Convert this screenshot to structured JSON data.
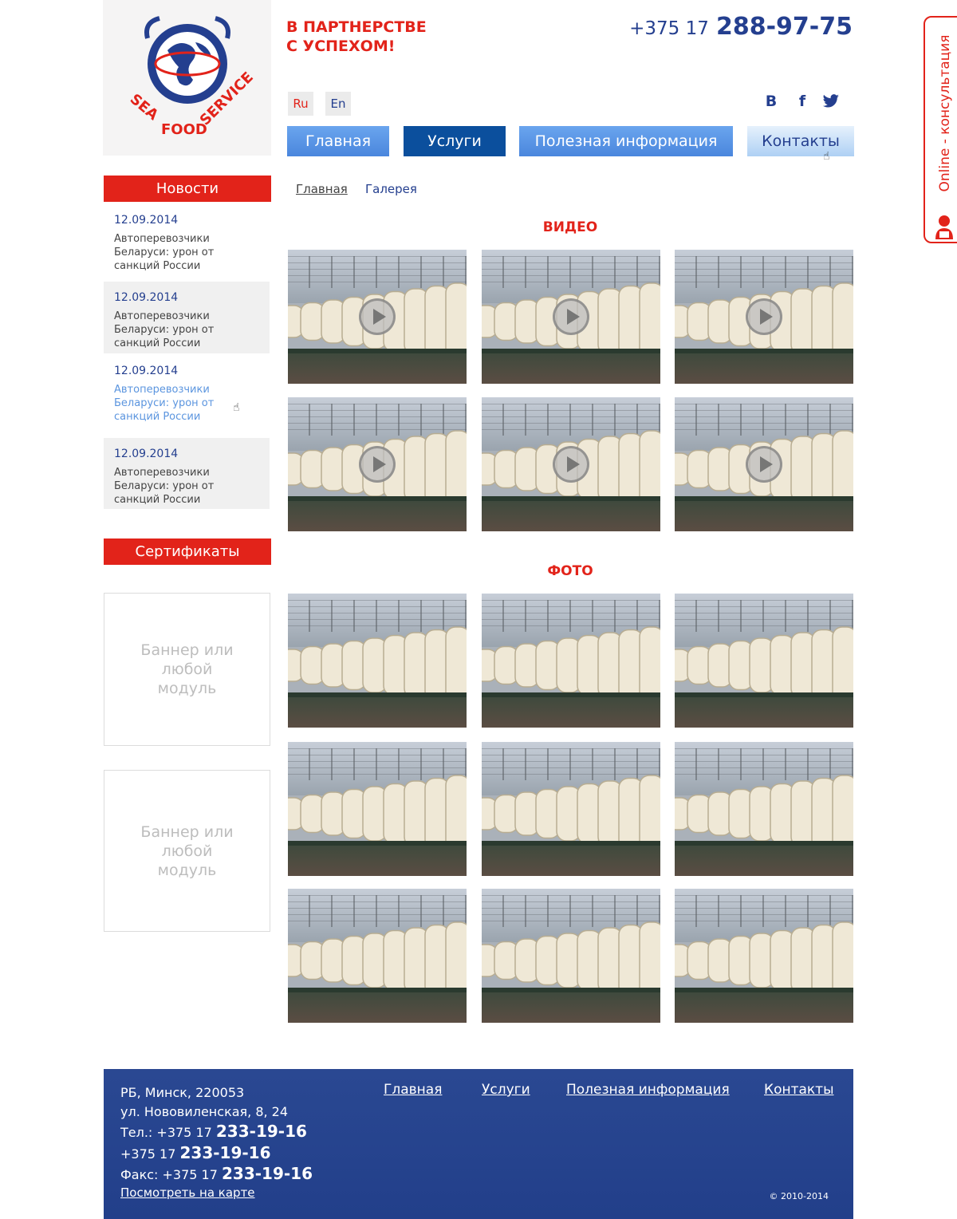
{
  "logo": {
    "text": "SEA FOOD SERVICE"
  },
  "header": {
    "slogan_line1": "В ПАРТНЕРСТВЕ",
    "slogan_line2": "С УСПЕХОМ!",
    "phone_prefix": "+375 17",
    "phone_number": "288-97-75"
  },
  "languages": [
    "Ru",
    "En"
  ],
  "social": [
    "B",
    "f",
    "twitter-icon"
  ],
  "nav": [
    {
      "label": "Главная"
    },
    {
      "label": "Услуги"
    },
    {
      "label": "Полезная информация"
    },
    {
      "label": "Контакты"
    }
  ],
  "sidebar": {
    "news_title": "Новости",
    "news": [
      {
        "date": "12.09.2014",
        "text": "Автоперевозчики Беларуси: урон от санкций России"
      },
      {
        "date": "12.09.2014",
        "text": "Автоперевозчики Беларуси: урон от санкций России"
      },
      {
        "date": "12.09.2014",
        "text": "Автоперевозчики Беларуси: урон от санкций России"
      },
      {
        "date": "12.09.2014",
        "text": "Автоперевозчики Беларуси: урон от санкций России"
      }
    ],
    "cert_title": "Сертификаты",
    "banner_text": "Баннер или любой модуль"
  },
  "breadcrumb": [
    "Главная",
    "Галерея"
  ],
  "sections": {
    "video_title": "ВИДЕО",
    "photo_title": "ФОТО"
  },
  "footer": {
    "address_line1": "РБ, Минск, 220053",
    "address_line2": "ул. Нововиленская, 8, 24",
    "tel_label": "Тел.: +375 17",
    "tel1": "233-19-16",
    "tel2_prefix": "+375 17",
    "tel2": "233-19-16",
    "fax_label": "Факс: +375 17",
    "fax": "233-19-16",
    "map_link": "Посмотреть на карте",
    "links": [
      "Главная",
      "Услуги",
      "Полезная информация",
      "Контакты"
    ],
    "copyright": "© 2010-2014"
  },
  "online_tab": "Online - консультация",
  "colors": {
    "red": "#e2231a",
    "blue": "#243f8f",
    "nav_active": "#0b4f9d",
    "nav": "#5a96e6"
  }
}
